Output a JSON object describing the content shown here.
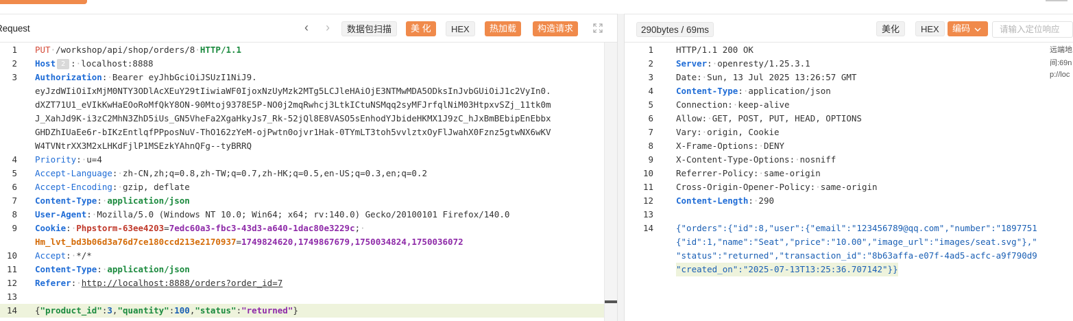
{
  "app": {
    "left_title": "Request",
    "right_title": "290bytes / 69ms",
    "toolbar_left": {
      "back_label": "‹",
      "forward_label": "›",
      "scan_label": "数据包扫描",
      "beautify_label": "美 化",
      "hex_label": "HEX",
      "hot_reload_label": "热加载",
      "build_request_label": "构造请求"
    },
    "toolbar_right": {
      "beautify_label": "美化",
      "hex_label": "HEX",
      "encode_label": "编码",
      "search_placeholder": "请输入定位响应"
    },
    "right_clip": [
      "远端地",
      "间:69n",
      "p://loc"
    ],
    "colors": {
      "accent": "#f08a4b",
      "header_key": "#1f6cd6",
      "json_key": "#1b8a3e",
      "json_number": "#1a5fb4",
      "json_string": "#8e2aa8",
      "verb": "#d54b39"
    }
  },
  "request": {
    "lines": [
      {
        "n": "1",
        "method": "PUT",
        "path": "/workshop/api/shop/orders/8",
        "version": "HTTP/1.1"
      },
      {
        "n": "2",
        "key": "Host",
        "badge": "2",
        "value": "localhost:8888"
      },
      {
        "n": "3",
        "key": "Authorization",
        "value": "Bearer eyJhbGciOiJSUzI1NiJ9."
      },
      {
        "n": "",
        "cont": "eyJzdWIiOiIxMjM0NTY3ODlAcXEuY29tIiwiaWF0IjoxNzUyMzk2MTg5LCJleHAiOjE3NTMwMDA5ODksInJvbGUiOiJ1c2VyIn0."
      },
      {
        "n": "",
        "cont": "dXZT71U1_eVIkKwHaEOoRoMfQkY8ON-90Mtoj9378E5P-NO0j2mqRwhcj3LtkICtuNSMqq2syMFJrfqlNiM03HtpxvSZj_11tk0m"
      },
      {
        "n": "",
        "cont": "J_XahJd9K-i3zC2MhN3ZhD5iUs_GN5VheFa2XgaHkyJs7_Rk-52jQl8E8VASO5sEnhodYJbideHKMX1J9zC_hJxBmBEbipEnEbbx"
      },
      {
        "n": "",
        "cont": "GHDZhIUaEe6r-bIKzEntlqfPPposNuV-ThO162zYeM-ojPwtn0ojvr1Hak-0TYmLT3toh5vvlztxOyFlJwahX0Fznz5gtwNX6wKV"
      },
      {
        "n": "",
        "cont": "W4TVNtrXX3M2xLHKdFjlP1MSEzkYAhnQFg--tyBRRQ"
      },
      {
        "n": "4",
        "key": "Priority",
        "value": "u=4"
      },
      {
        "n": "5",
        "key": "Accept-Language",
        "value": "zh-CN,zh;q=0.8,zh-TW;q=0.7,zh-HK;q=0.5,en-US;q=0.3,en;q=0.2"
      },
      {
        "n": "6",
        "key": "Accept-Encoding",
        "value": "gzip, deflate"
      },
      {
        "n": "7",
        "key": "Content-Type",
        "value": "application/json"
      },
      {
        "n": "8",
        "key": "User-Agent",
        "value": "Mozilla/5.0 (Windows NT 10.0; Win64; x64; rv:140.0) Gecko/20100101 Firefox/140.0"
      },
      {
        "n": "9",
        "key": "Cookie",
        "c1k": "Phpstorm-63ee4203",
        "c1v": "7edc60a3-fbc3-43d3-a640-1dac80e3229c",
        "sep": ";"
      },
      {
        "n": "",
        "c2k": "Hm_lvt_bd3b06d3a76d7ce180ccd213e2170937",
        "c2v": "1749824620,1749867679,1750034824,1750036072"
      },
      {
        "n": "10",
        "key": "Accept",
        "value": "*/*"
      },
      {
        "n": "11",
        "key": "Content-Type",
        "value": "application/json"
      },
      {
        "n": "12",
        "key": "Referer",
        "value": "http://localhost:8888/orders?order_id=7"
      },
      {
        "n": "13"
      },
      {
        "n": "14",
        "body": {
          "k1": "\"product_id\"",
          "v1": "3",
          "k2": "\"quantity\"",
          "v2": "100",
          "k3": "\"status\"",
          "v3": "\"returned\""
        }
      }
    ]
  },
  "response": {
    "lines": [
      {
        "n": "1",
        "status": "HTTP/1.1 200 OK"
      },
      {
        "n": "2",
        "key": "Server",
        "value": "openresty/1.25.3.1",
        "bold": true
      },
      {
        "n": "3",
        "key": "Date",
        "value": "Sun, 13 Jul 2025 13:26:57 GMT"
      },
      {
        "n": "4",
        "key": "Content-Type",
        "value": "application/json",
        "bold": true
      },
      {
        "n": "5",
        "key": "Connection",
        "value": "keep-alive"
      },
      {
        "n": "6",
        "key": "Allow",
        "value": "GET, POST, PUT, HEAD, OPTIONS"
      },
      {
        "n": "7",
        "key": "Vary",
        "value": "origin, Cookie"
      },
      {
        "n": "8",
        "key": "X-Frame-Options",
        "value": "DENY"
      },
      {
        "n": "9",
        "key": "X-Content-Type-Options",
        "value": "nosniff"
      },
      {
        "n": "10",
        "key": "Referrer-Policy",
        "value": "same-origin"
      },
      {
        "n": "11",
        "key": "Cross-Origin-Opener-Policy",
        "value": "same-origin"
      },
      {
        "n": "12",
        "key": "Content-Length",
        "value": "290",
        "bold": true
      },
      {
        "n": "13"
      },
      {
        "n": "14",
        "json": "{\"orders\":{\"id\":8,\"user\":{\"email\":\"123456789@qq.com\",\"number\":\"1897751"
      },
      {
        "n": "",
        "json": "{\"id\":1,\"name\":\"Seat\",\"price\":\"10.00\",\"image_url\":\"images/seat.svg\"},\""
      },
      {
        "n": "",
        "json": "\"status\":\"returned\",\"transaction_id\":\"8b63affa-e07f-4ad5-acfc-a9f790d9"
      },
      {
        "n": "",
        "json": "\"created_on\":\"2025-07-13T13:25:36.707142\"}}",
        "highlight": true
      }
    ]
  }
}
